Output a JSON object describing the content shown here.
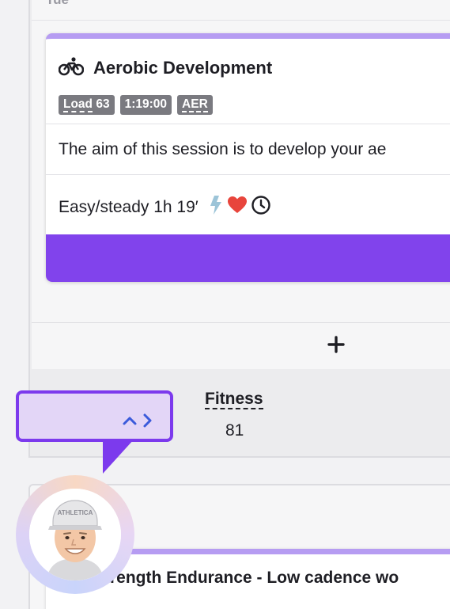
{
  "day": {
    "label": "Tue"
  },
  "workout": {
    "sport_icon": "bike-icon",
    "title": "Aerobic Development",
    "tags": [
      {
        "prefix": "Load",
        "value": "63"
      },
      {
        "value": "1:19:00"
      },
      {
        "value": "AER"
      }
    ],
    "description": "The aim of this session is to develop your ae",
    "intensity_text": "Easy/steady 1h 19′",
    "intensity_icons": [
      "lightning-icon",
      "heart-icon",
      "clock-icon"
    ],
    "accent_color": "#8143ec"
  },
  "add_button": {
    "icon": "plus-icon"
  },
  "fitness": {
    "label": "Fitness",
    "value": "81"
  },
  "next_workout": {
    "title": "trength Endurance - Low cadence wo"
  },
  "helper": {
    "toggle_icon": "expand-code-icon",
    "avatar_text": "ATHLETICA"
  }
}
